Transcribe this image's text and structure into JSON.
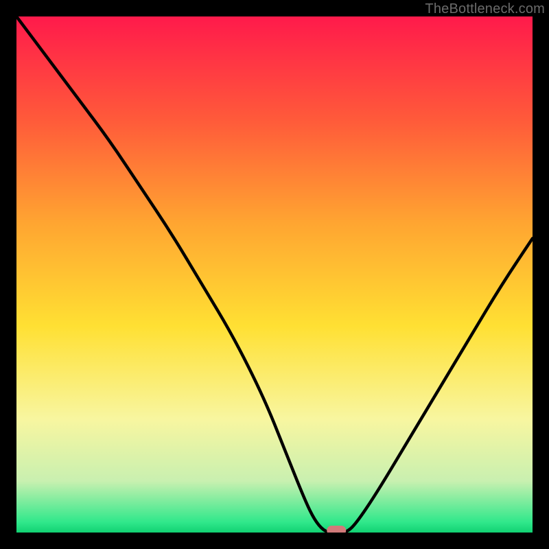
{
  "watermark": "TheBottleneck.com",
  "chart_data": {
    "type": "line",
    "title": "",
    "xlabel": "",
    "ylabel": "",
    "xlim": [
      0,
      100
    ],
    "ylim": [
      0,
      100
    ],
    "legend": false,
    "grid": false,
    "background_gradient": {
      "direction": "vertical",
      "stops": [
        {
          "offset": 0.0,
          "color": "#ff1a4b"
        },
        {
          "offset": 0.2,
          "color": "#ff5a3a"
        },
        {
          "offset": 0.4,
          "color": "#ffa531"
        },
        {
          "offset": 0.6,
          "color": "#ffe033"
        },
        {
          "offset": 0.78,
          "color": "#f8f6a0"
        },
        {
          "offset": 0.9,
          "color": "#c9f0b0"
        },
        {
          "offset": 0.98,
          "color": "#30e88b"
        },
        {
          "offset": 1.0,
          "color": "#11d172"
        }
      ]
    },
    "series": [
      {
        "name": "bottleneck-curve",
        "color": "#000000",
        "x": [
          0,
          6,
          12,
          18,
          24,
          30,
          36,
          42,
          48,
          52,
          56,
          58,
          60,
          62,
          64,
          66,
          70,
          76,
          82,
          88,
          94,
          100
        ],
        "y": [
          100,
          92,
          84,
          76,
          67,
          58,
          48,
          38,
          26,
          16,
          6,
          2,
          0,
          0,
          0,
          2,
          8,
          18,
          28,
          38,
          48,
          57
        ]
      }
    ],
    "marker": {
      "name": "optimal-point",
      "x": 62,
      "y": 0,
      "color": "#d17a7a",
      "shape": "capsule"
    }
  }
}
